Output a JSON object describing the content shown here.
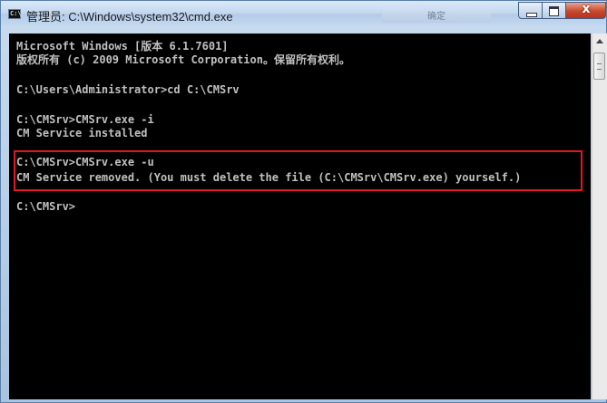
{
  "window": {
    "title": "管理员: C:\\Windows\\system32\\cmd.exe",
    "icon_text": "C:\\",
    "faded_tab_label": "确定",
    "controls": {
      "minimize_icon": "minimize-icon",
      "maximize_icon": "maximize-icon",
      "close_label": "x"
    }
  },
  "console": {
    "lines": [
      "Microsoft Windows [版本 6.1.7601]",
      "版权所有 (c) 2009 Microsoft Corporation。保留所有权利。",
      "",
      "C:\\Users\\Administrator>cd C:\\CMSrv",
      "",
      "C:\\CMSrv>CMSrv.exe -i",
      "CM Service installed",
      "",
      "C:\\CMSrv>CMSrv.exe -u",
      "CM Service removed. (You must delete the file (C:\\CMSrv\\CMSrv.exe) yourself.)",
      "",
      "C:\\CMSrv>"
    ],
    "text_color": "#c0c0c0",
    "background": "#000000",
    "highlight_color": "#e3171d"
  }
}
